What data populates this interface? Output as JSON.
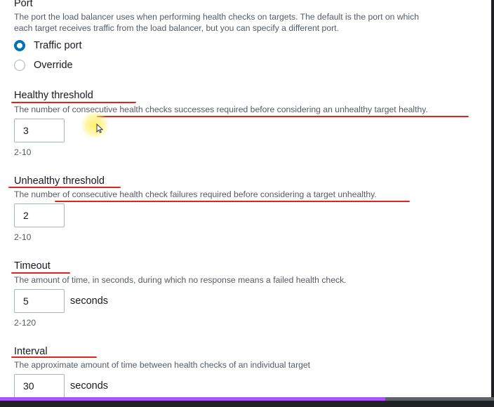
{
  "port": {
    "title": "Port",
    "description": "The port the load balancer uses when performing health checks on targets. The default is the port on which",
    "description_line2": "each target receives traffic from the load balancer, but you can specify a different port.",
    "options": [
      {
        "label": "Traffic port",
        "selected": true
      },
      {
        "label": "Override",
        "selected": false
      }
    ]
  },
  "healthy_threshold": {
    "title": "Healthy threshold",
    "description": "The number of consecutive health checks successes required before considering an unhealthy target healthy.",
    "value": "3",
    "constraint": "2-10"
  },
  "unhealthy_threshold": {
    "title": "Unhealthy threshold",
    "description": "The number of consecutive health check failures required before considering a target unhealthy.",
    "value": "2",
    "constraint": "2-10"
  },
  "timeout": {
    "title": "Timeout",
    "description": "The amount of time, in seconds, during which no response means a failed health check.",
    "value": "5",
    "unit": "seconds",
    "constraint": "2-120"
  },
  "interval": {
    "title": "Interval",
    "description": "The approximate amount of time between health checks of an individual target",
    "value": "30",
    "unit": "seconds"
  },
  "video_progress": {
    "fraction": 0.78
  },
  "colors": {
    "radio_selected": "#0073bb",
    "annotation_underline": "#e1251b",
    "progress_fill": "#a855f7"
  }
}
